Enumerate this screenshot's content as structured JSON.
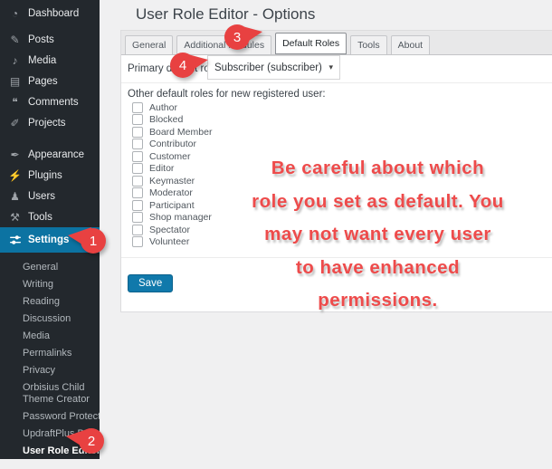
{
  "header": {
    "title": "User Role Editor - Options"
  },
  "sidebar": {
    "items": [
      {
        "label": "Dashboard",
        "glyph": "◔"
      },
      {
        "label": "Posts",
        "glyph": "✎"
      },
      {
        "label": "Media",
        "glyph": "♪"
      },
      {
        "label": "Pages",
        "glyph": "▤"
      },
      {
        "label": "Comments",
        "glyph": "❝"
      },
      {
        "label": "Projects",
        "glyph": "✐"
      },
      {
        "label": "Appearance",
        "glyph": "✒"
      },
      {
        "label": "Plugins",
        "glyph": "⚡"
      },
      {
        "label": "Users",
        "glyph": "♟"
      },
      {
        "label": "Tools",
        "glyph": "⚒"
      },
      {
        "label": "Settings"
      }
    ],
    "settings_submenu": [
      {
        "label": "General"
      },
      {
        "label": "Writing"
      },
      {
        "label": "Reading"
      },
      {
        "label": "Discussion"
      },
      {
        "label": "Media"
      },
      {
        "label": "Permalinks"
      },
      {
        "label": "Privacy"
      },
      {
        "label": "Orbisius Child Theme Creator"
      },
      {
        "label": "Password Protected"
      },
      {
        "label": "UpdraftPlus Backups"
      },
      {
        "label": "User Role Editor",
        "current": true
      }
    ]
  },
  "tabs": [
    {
      "label": "General"
    },
    {
      "label": "Additional Modules"
    },
    {
      "label": "Default Roles",
      "active": true
    },
    {
      "label": "Tools"
    },
    {
      "label": "About"
    }
  ],
  "options_panel": {
    "primary_role_label": "Primary default role:",
    "primary_role_value": "Subscriber (subscriber)",
    "dropdown_arrow": "▾",
    "other_roles_label": "Other default roles for new registered user:",
    "roles": [
      "Author",
      "Blocked",
      "Board Member",
      "Contributor",
      "Customer",
      "Editor",
      "Keymaster",
      "Moderator",
      "Participant",
      "Shop manager",
      "Spectator",
      "Volunteer"
    ],
    "save_label": "Save"
  },
  "annotation": {
    "lines": [
      "Be careful about which",
      "role you set as default. You",
      "may not want every user",
      "to have enhanced",
      "permissions."
    ]
  },
  "callouts": [
    {
      "number": "1"
    },
    {
      "number": "2"
    },
    {
      "number": "3"
    },
    {
      "number": "4"
    }
  ],
  "colors": {
    "sidebar_bg": "#23282d",
    "selected_menu_bg": "#0c73a2",
    "callout_red": "#e84141",
    "annotation_red": "#ee4b4b",
    "save_button_bg": "#1079ab"
  }
}
